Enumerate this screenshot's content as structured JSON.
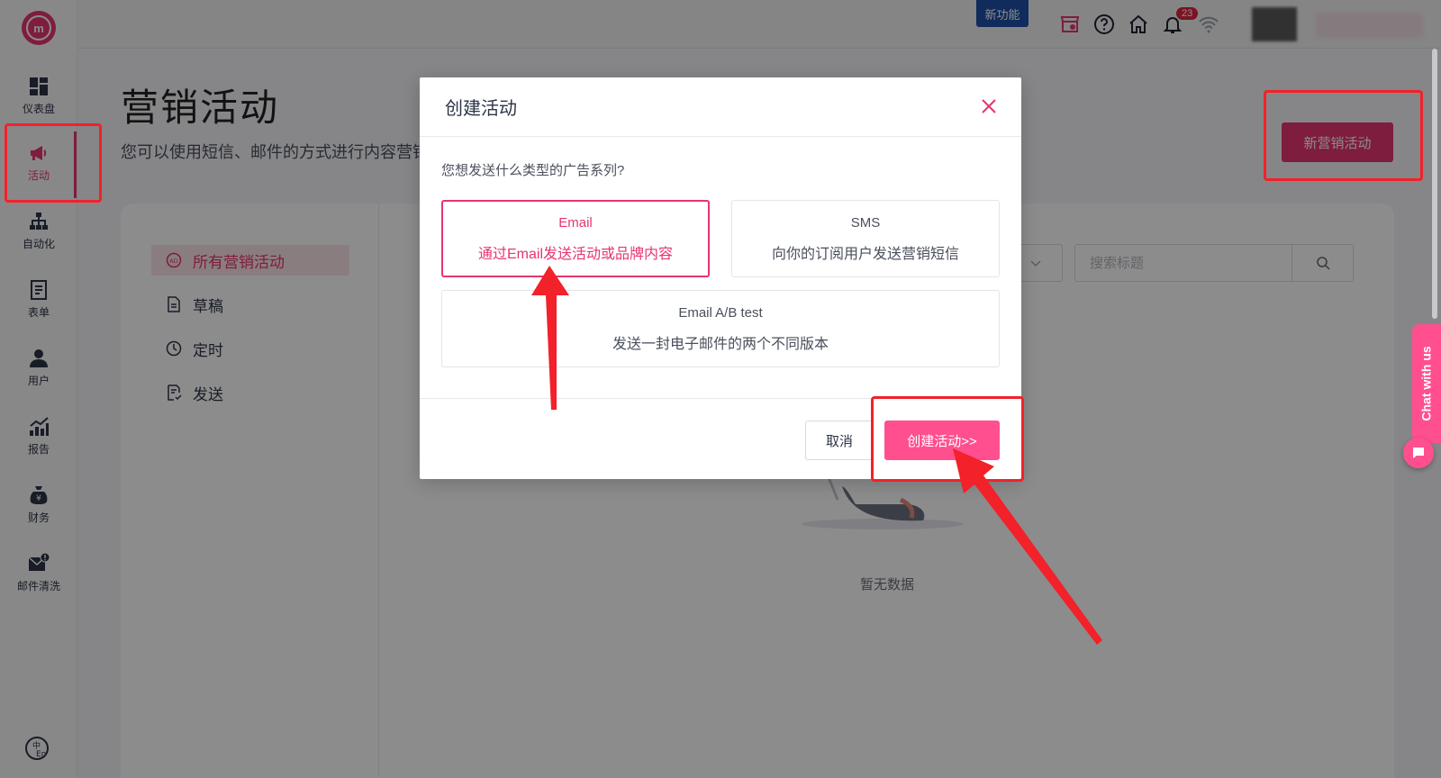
{
  "sidebar": {
    "items": [
      {
        "label": "仪表盘",
        "icon": "dashboard-icon"
      },
      {
        "label": "活动",
        "icon": "megaphone-icon"
      },
      {
        "label": "自动化",
        "icon": "sitemap-icon"
      },
      {
        "label": "表单",
        "icon": "form-icon"
      },
      {
        "label": "用户",
        "icon": "user-icon"
      },
      {
        "label": "报告",
        "icon": "chart-icon"
      },
      {
        "label": "财务",
        "icon": "money-bag-icon"
      },
      {
        "label": "邮件清洗",
        "icon": "mail-clean-icon"
      }
    ],
    "active_index": 1
  },
  "header": {
    "new_feature": "新功能",
    "notification_count": "23"
  },
  "page": {
    "title": "营销活动",
    "description": "您可以使用短信、邮件的方式进行内容营销",
    "new_button": "新营销活动"
  },
  "left_menu": {
    "items": [
      "所有营销活动",
      "草稿",
      "定时",
      "发送"
    ]
  },
  "search": {
    "placeholder": "搜索标题"
  },
  "empty": {
    "text": "暂无数据"
  },
  "chat": {
    "label": "Chat with us"
  },
  "modal": {
    "title": "创建活动",
    "question": "您想发送什么类型的广告系列?",
    "options": [
      {
        "title": "Email",
        "desc": "通过Email发送活动或品牌内容"
      },
      {
        "title": "SMS",
        "desc": "向你的订阅用户发送营销短信"
      },
      {
        "title": "Email A/B test",
        "desc": "发送一封电子邮件的两个不同版本"
      }
    ],
    "selected_index": 0,
    "cancel": "取消",
    "create": "创建活动>>"
  },
  "colors": {
    "accent": "#e5356f",
    "accent_light": "#ff4f8f",
    "highlight_box": "#f2212a",
    "feature_badge": "#1e4fa8"
  }
}
